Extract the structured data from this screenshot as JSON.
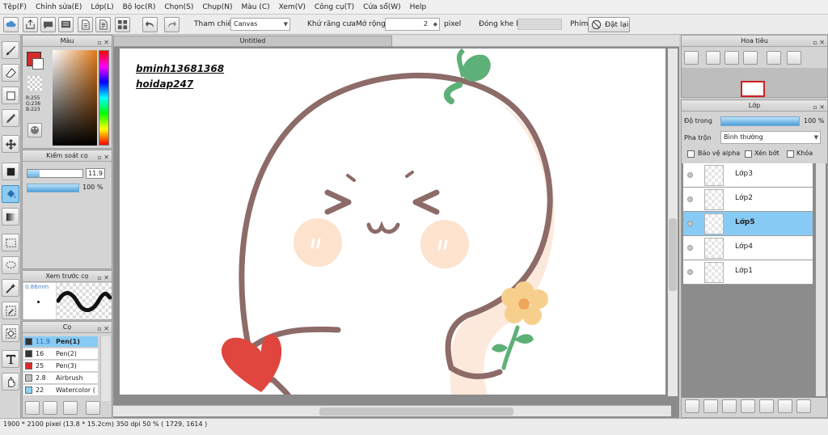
{
  "menu": [
    "Tệp(F)",
    "Chỉnh sửa(E)",
    "Lớp(L)",
    "Bộ lọc(R)",
    "Chọn(S)",
    "Chụp(N)",
    "Màu (C)",
    "Xem(V)",
    "Công cụ(T)",
    "Cửa sổ(W)",
    "Help"
  ],
  "toolbar": {
    "reference_label": "Tham chiếu",
    "reference_value": "Canvas",
    "antialias_label": "Khử răng cưa",
    "expand_label": "Mở rộng",
    "expand_value": "2",
    "expand_unit": "pixel",
    "gap_label": "Đóng khe hở",
    "key_label": "Phím",
    "reset_label": "Đặt lại"
  },
  "color_panel": {
    "title": "Màu",
    "r": "R:255",
    "g": "G:236",
    "b": "B:223",
    "primary_color": "#d62b2b"
  },
  "brush_control": {
    "title": "Kiểm soát cọ",
    "size": "11.9",
    "opacity": "100 %"
  },
  "brush_preview": {
    "title": "Xem trước cọ",
    "size": "0.86mm"
  },
  "brushes": {
    "title": "Cọ",
    "items": [
      {
        "size": "11.9",
        "name": "Pen(1)",
        "color": "#333333"
      },
      {
        "size": "16",
        "name": "Pen(2)",
        "color": "#333333"
      },
      {
        "size": "25",
        "name": "Pen(3)",
        "color": "#d82a2a"
      },
      {
        "size": "2.8",
        "name": "Airbrush",
        "color": "#bdbdbd"
      },
      {
        "size": "22",
        "name": "Watercolor (",
        "color": "#8fd4ef"
      }
    ]
  },
  "document": {
    "tab_title": "Untitled",
    "watermark_line1": "bminh13681368",
    "watermark_line2": "hoidap247"
  },
  "navigator": {
    "title": "Hoa tiêu"
  },
  "layers": {
    "title": "Lớp",
    "opacity_label": "Độ trong",
    "opacity_value": "100 %",
    "blend_label": "Pha trộn",
    "blend_value": "Bình thường",
    "protect_alpha_label": "Bảo vệ alpha",
    "clip_label": "Xén bớt",
    "lock_label": "Khóa",
    "items": [
      "Lớp3",
      "Lớp2",
      "Lớp5",
      "Lớp4",
      "Lớp1"
    ],
    "selected": "Lớp5"
  },
  "status": {
    "text": "1900 * 2100 pixel  (13.8 * 15.2cm)  350 dpi  50 %  ( 1729, 1614 )"
  }
}
